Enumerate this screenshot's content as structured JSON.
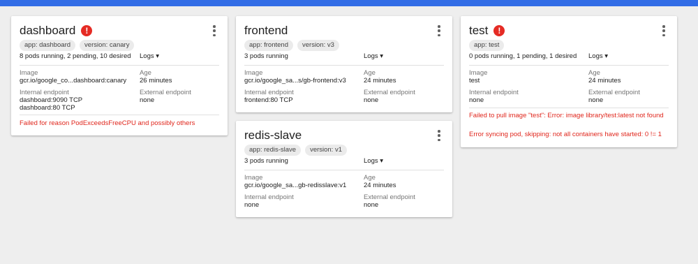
{
  "theme": {
    "accent": "#326de6",
    "error": "#e52b24"
  },
  "cards": {
    "dashboard": {
      "title": "dashboard",
      "error_icon": "!",
      "chips": [
        "app: dashboard",
        "version: canary"
      ],
      "status": "8 pods running, 2 pending, 10 desired",
      "logs": "Logs ▾",
      "image_label": "Image",
      "image": "gcr.io/google_co...dashboard:canary",
      "age_label": "Age",
      "age": "26 minutes",
      "internal_label": "Internal endpoint",
      "internal": [
        "dashboard:9090 TCP",
        "dashboard:80 TCP"
      ],
      "external_label": "External endpoint",
      "external": "none",
      "errors": [
        "Failed for reason PodExceedsFreeCPU and possibly others"
      ]
    },
    "frontend": {
      "title": "frontend",
      "chips": [
        "app: frontend",
        "version: v3"
      ],
      "status": "3 pods running",
      "logs": "Logs ▾",
      "image_label": "Image",
      "image": "gcr.io/google_sa...s/gb-frontend:v3",
      "age_label": "Age",
      "age": "24 minutes",
      "internal_label": "Internal endpoint",
      "internal": [
        "frontend:80 TCP"
      ],
      "external_label": "External endpoint",
      "external": "none"
    },
    "redis_slave": {
      "title": "redis-slave",
      "chips": [
        "app: redis-slave",
        "version: v1"
      ],
      "status": "3 pods running",
      "logs": "Logs ▾",
      "image_label": "Image",
      "image": "gcr.io/google_sa...gb-redisslave:v1",
      "age_label": "Age",
      "age": "24 minutes",
      "internal_label": "Internal endpoint",
      "internal": [
        "none"
      ],
      "external_label": "External endpoint",
      "external": "none"
    },
    "test": {
      "title": "test",
      "error_icon": "!",
      "chips": [
        "app: test"
      ],
      "status": "0 pods running, 1 pending, 1 desired",
      "logs": "Logs ▾",
      "image_label": "Image",
      "image": "test",
      "age_label": "Age",
      "age": "24 minutes",
      "internal_label": "Internal endpoint",
      "internal": [
        "none"
      ],
      "external_label": "External endpoint",
      "external": "none",
      "errors": [
        "Failed to pull image \"test\": Error: image library/test:latest not found",
        "Error syncing pod, skipping: not all containers have started: 0 != 1"
      ]
    }
  }
}
